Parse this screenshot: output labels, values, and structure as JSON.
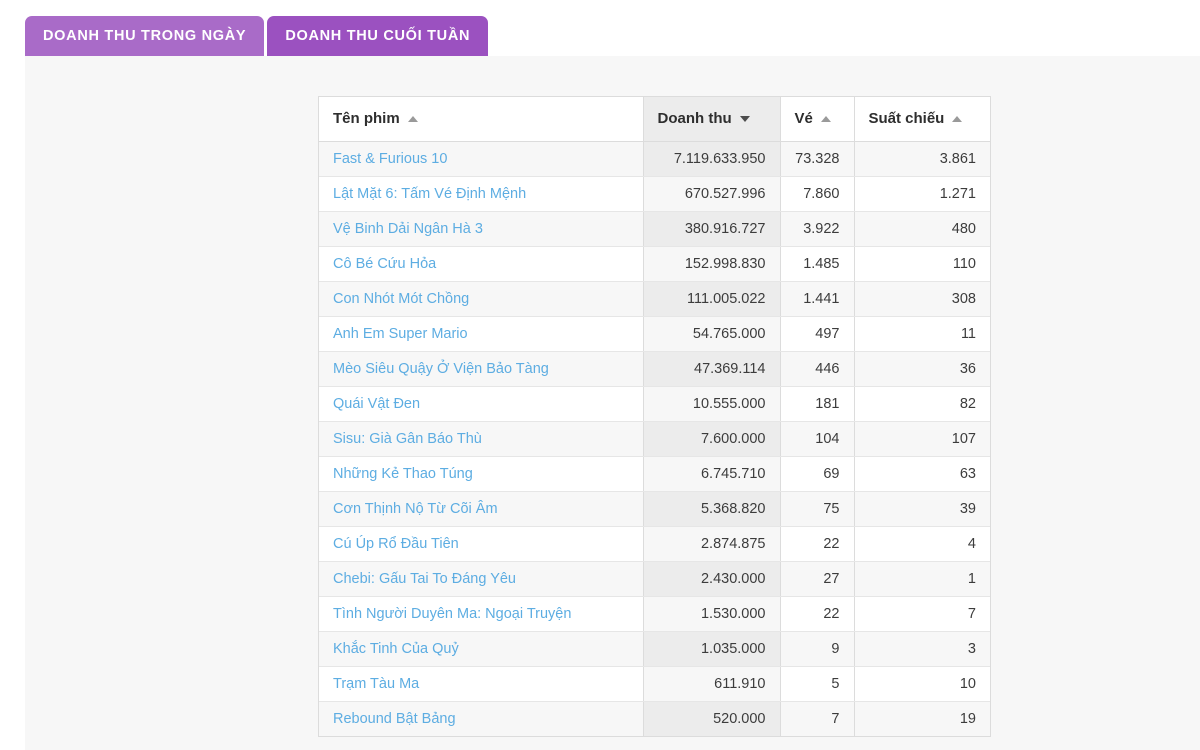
{
  "tabs": [
    {
      "label": "DOANH THU TRONG NGÀY",
      "active": false
    },
    {
      "label": "DOANH THU CUỐI TUẦN",
      "active": true
    }
  ],
  "colors": {
    "tab_inactive": "#a96bc8",
    "tab_active": "#9b51c0",
    "link": "#5dade2",
    "panel_bg": "#f7f7f7",
    "row_stripe": "#f7f7f7",
    "sorted_column_bg": "#ececec"
  },
  "table": {
    "columns": [
      {
        "key": "name",
        "label": "Tên phim",
        "sort": "asc",
        "align": "left"
      },
      {
        "key": "revenue",
        "label": "Doanh thu",
        "sort": "desc",
        "align": "right"
      },
      {
        "key": "tickets",
        "label": "Vé",
        "sort": "asc",
        "align": "right"
      },
      {
        "key": "shows",
        "label": "Suất chiếu",
        "sort": "asc",
        "align": "right"
      }
    ],
    "sorted_by": "revenue",
    "rows": [
      {
        "name": "Fast & Furious 10",
        "revenue": "7.119.633.950",
        "tickets": "73.328",
        "shows": "3.861"
      },
      {
        "name": "Lật Mặt 6: Tấm Vé Định Mệnh",
        "revenue": "670.527.996",
        "tickets": "7.860",
        "shows": "1.271"
      },
      {
        "name": "Vệ Binh Dải Ngân Hà 3",
        "revenue": "380.916.727",
        "tickets": "3.922",
        "shows": "480"
      },
      {
        "name": "Cô Bé Cứu Hỏa",
        "revenue": "152.998.830",
        "tickets": "1.485",
        "shows": "110"
      },
      {
        "name": "Con Nhót Mót Chồng",
        "revenue": "111.005.022",
        "tickets": "1.441",
        "shows": "308"
      },
      {
        "name": "Anh Em Super Mario",
        "revenue": "54.765.000",
        "tickets": "497",
        "shows": "11"
      },
      {
        "name": "Mèo Siêu Quậy Ở Viện Bảo Tàng",
        "revenue": "47.369.114",
        "tickets": "446",
        "shows": "36"
      },
      {
        "name": "Quái Vật Đen",
        "revenue": "10.555.000",
        "tickets": "181",
        "shows": "82"
      },
      {
        "name": "Sisu: Già Gân Báo Thù",
        "revenue": "7.600.000",
        "tickets": "104",
        "shows": "107"
      },
      {
        "name": "Những Kẻ Thao Túng",
        "revenue": "6.745.710",
        "tickets": "69",
        "shows": "63"
      },
      {
        "name": "Cơn Thịnh Nộ Từ Cõi Âm",
        "revenue": "5.368.820",
        "tickets": "75",
        "shows": "39"
      },
      {
        "name": "Cú Úp Rổ Đầu Tiên",
        "revenue": "2.874.875",
        "tickets": "22",
        "shows": "4"
      },
      {
        "name": "Chebi: Gấu Tai To Đáng Yêu",
        "revenue": "2.430.000",
        "tickets": "27",
        "shows": "1"
      },
      {
        "name": "Tình Người Duyên Ma: Ngoại Truyện",
        "revenue": "1.530.000",
        "tickets": "22",
        "shows": "7"
      },
      {
        "name": "Khắc Tinh Của Quỷ",
        "revenue": "1.035.000",
        "tickets": "9",
        "shows": "3"
      },
      {
        "name": "Trạm Tàu Ma",
        "revenue": "611.910",
        "tickets": "5",
        "shows": "10"
      },
      {
        "name": "Rebound Bật Bảng",
        "revenue": "520.000",
        "tickets": "7",
        "shows": "19"
      }
    ]
  }
}
